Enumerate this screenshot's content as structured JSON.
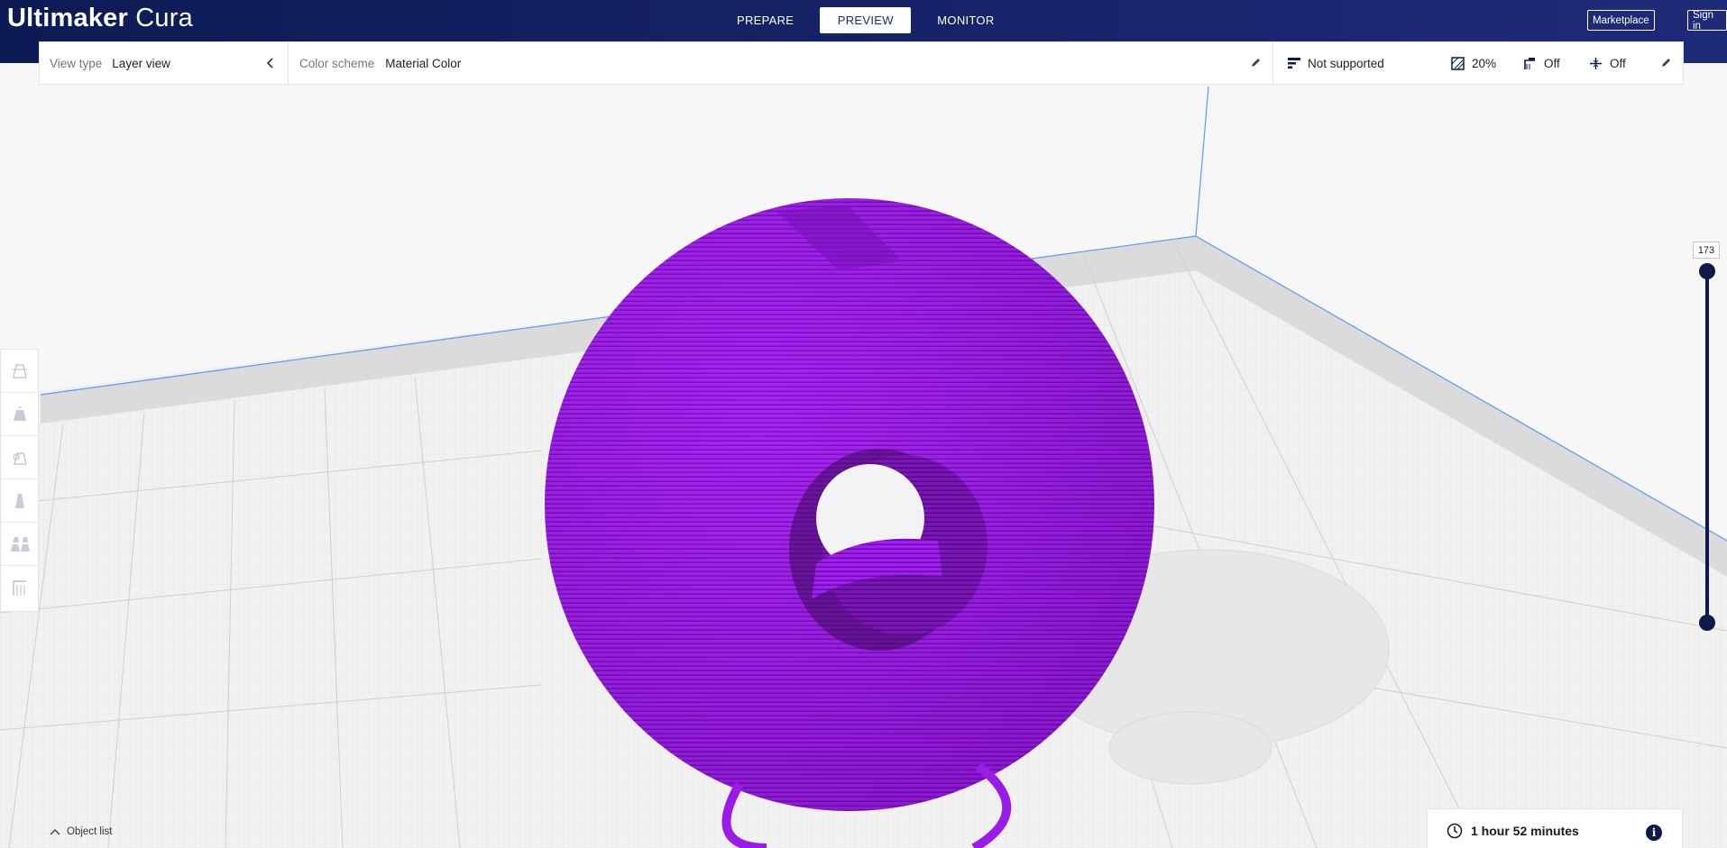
{
  "app": {
    "name_bold": "Ultimaker",
    "name_light": "Cura"
  },
  "stages": [
    {
      "label": "PREPARE",
      "active": false
    },
    {
      "label": "PREVIEW",
      "active": true
    },
    {
      "label": "MONITOR",
      "active": false
    }
  ],
  "header": {
    "marketplace_label": "Marketplace",
    "signin_label": "Sign in"
  },
  "view_type": {
    "label": "View type",
    "value": "Layer view"
  },
  "color_scheme": {
    "label": "Color scheme",
    "value": "Material Color"
  },
  "print_setup": {
    "support": "Not supported",
    "infill": "20%",
    "support_toggle": "Off",
    "adhesion": "Off"
  },
  "tools": [
    {
      "name": "tool-move"
    },
    {
      "name": "tool-scale"
    },
    {
      "name": "tool-rotate"
    },
    {
      "name": "tool-mirror"
    },
    {
      "name": "tool-per-model-settings"
    },
    {
      "name": "tool-support-blocker"
    }
  ],
  "layer_slider": {
    "current_layer": "173",
    "fill_fraction": 1.0
  },
  "object_list": {
    "label": "Object list"
  },
  "print_estimate": {
    "time": "1 hour 52 minutes"
  },
  "colors": {
    "header": "#18246a",
    "accent": "#0d1a4b",
    "model": "#a020f0"
  }
}
